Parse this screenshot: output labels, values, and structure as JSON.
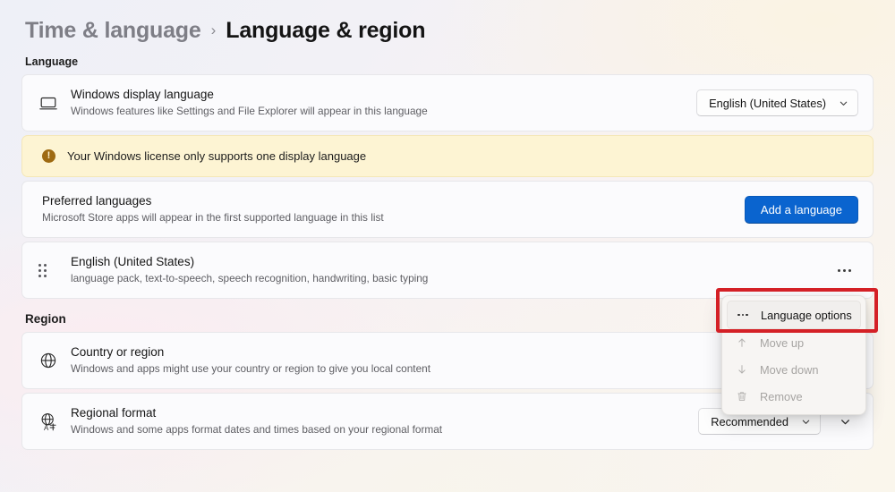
{
  "breadcrumb": {
    "parent": "Time & language",
    "separator": "›",
    "current": "Language & region"
  },
  "sections": {
    "language": {
      "heading": "Language",
      "display_language": {
        "icon": "monitor-icon",
        "title": "Windows display language",
        "subtitle": "Windows features like Settings and File Explorer will appear in this language",
        "dropdown_value": "English (United States)"
      },
      "warning": {
        "icon": "warning-circle-icon",
        "glyph": "!",
        "text": "Your Windows license only supports one display language"
      },
      "preferred_languages": {
        "title": "Preferred languages",
        "subtitle": "Microsoft Store apps will appear in the first supported language in this list",
        "button_label": "Add a language"
      },
      "language_item": {
        "title": "English (United States)",
        "subtitle": "language pack, text-to-speech, speech recognition, handwriting, basic typing"
      }
    },
    "region": {
      "heading": "Region",
      "country_or_region": {
        "icon": "globe-icon",
        "title": "Country or region",
        "subtitle": "Windows and apps might use your country or region to give you local content"
      },
      "regional_format": {
        "icon": "globe-translate-icon",
        "title": "Regional format",
        "subtitle": "Windows and some apps format dates and times based on your regional format",
        "dropdown_value": "Recommended"
      }
    }
  },
  "context_menu": {
    "items": [
      {
        "label": "Language options",
        "icon": "ellipsis-icon",
        "enabled": true
      },
      {
        "label": "Move up",
        "icon": "arrow-up-icon",
        "enabled": false
      },
      {
        "label": "Move down",
        "icon": "arrow-down-icon",
        "enabled": false
      },
      {
        "label": "Remove",
        "icon": "trash-icon",
        "enabled": false
      }
    ]
  },
  "colors": {
    "accent": "#0a64cf",
    "annotation": "#d42026",
    "warning_bg": "#fdf4d3",
    "warning_icon": "#9e6a12",
    "card_bg": "#fbfbfd"
  }
}
